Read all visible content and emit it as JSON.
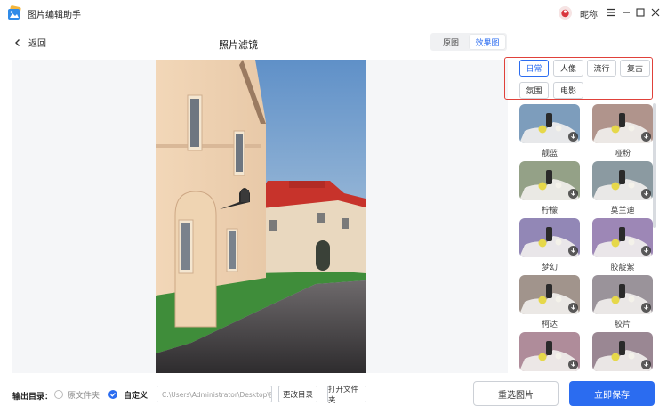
{
  "app": {
    "title": "图片编辑助手",
    "nickname": "昵称"
  },
  "header": {
    "back_label": "返回",
    "page_title": "照片滤镜",
    "view_tabs": [
      "原图",
      "效果图"
    ],
    "active_view": "效果图"
  },
  "categories": [
    "日常",
    "人像",
    "流行",
    "复古",
    "氛围",
    "电影"
  ],
  "active_category": "日常",
  "filters": [
    {
      "name": "靓蓝",
      "tint": "#8fb3d6"
    },
    {
      "name": "哑粉",
      "tint": "#c9a9a0"
    },
    {
      "name": "柠檬",
      "tint": "#a9b89a"
    },
    {
      "name": "莫兰迪",
      "tint": "#9fb0b8"
    },
    {
      "name": "梦幻",
      "tint": "#a79ad0"
    },
    {
      "name": "胶靛紫",
      "tint": "#b39ad0"
    },
    {
      "name": "柯达",
      "tint": "#b8a9a0"
    },
    {
      "name": "胶片",
      "tint": "#b0a8b0"
    },
    {
      "name": "",
      "tint": "#c8a0b0"
    },
    {
      "name": "",
      "tint": "#b09aa8"
    }
  ],
  "output": {
    "label": "输出目录：",
    "option_original": "原文件夹",
    "option_custom": "自定义",
    "selected": "自定义",
    "path": "C:\\Users\\Administrator\\Desktop\\图",
    "change_dir_label": "更改目录",
    "open_folder_label": "打开文件夹"
  },
  "actions": {
    "reselect_label": "重选图片",
    "save_label": "立即保存"
  },
  "colors": {
    "accent": "#2b6cf0",
    "highlight_border": "#e0413a"
  }
}
